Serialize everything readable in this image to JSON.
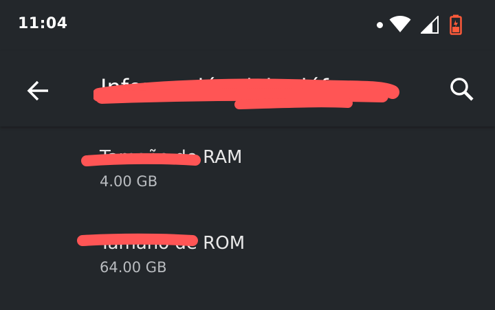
{
  "status_bar": {
    "time": "11:04",
    "icons": [
      "notification-dot-icon",
      "wifi-icon",
      "cell-signal-icon",
      "battery-low-icon"
    ],
    "battery_color": "#ff5a3a"
  },
  "app_bar": {
    "title": "Información del teléf…",
    "back_icon": "arrow-left-icon",
    "search_icon": "search-icon"
  },
  "items": [
    {
      "title": "Tamaño de RAM",
      "value": "4.00 GB"
    },
    {
      "title": "Tamaño de ROM",
      "value": "64.00 GB"
    }
  ],
  "colors": {
    "background": "#23272b",
    "redaction": "#ff5555",
    "text_primary": "#e8e8e8",
    "text_secondary": "#b9bcc0"
  }
}
